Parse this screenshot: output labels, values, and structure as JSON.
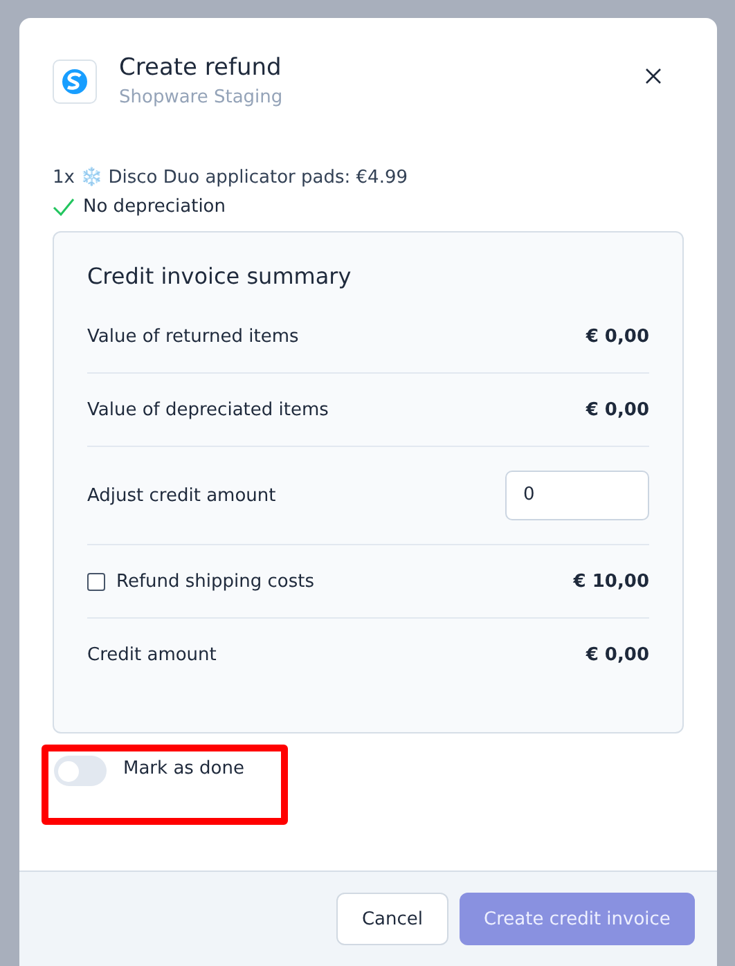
{
  "dialog": {
    "title": "Create refund",
    "subtitle": "Shopware Staging",
    "item": {
      "quantity": "1x",
      "emoji": "❄️",
      "text": "Disco Duo applicator pads: €4.99"
    },
    "depreciation": "No depreciation",
    "summary": {
      "title": "Credit invoice summary",
      "rows": [
        {
          "kind": "value",
          "label": "Value of returned items",
          "value": "€ 0,00"
        },
        {
          "kind": "value",
          "label": "Value of depreciated items",
          "value": "€ 0,00"
        },
        {
          "kind": "input",
          "label": "Adjust credit amount",
          "value": "0"
        },
        {
          "kind": "checkbox",
          "label": "Refund shipping costs",
          "checked": false,
          "value": "€ 10,00"
        },
        {
          "kind": "value",
          "label": "Credit amount",
          "value": "€ 0,00"
        }
      ]
    },
    "toggle": {
      "label": "Mark as done",
      "on": false,
      "highlighted": true
    },
    "buttons": [
      {
        "label": "Cancel",
        "kind": "secondary",
        "disabled": false
      },
      {
        "label": "Create credit invoice",
        "kind": "primary",
        "disabled": true
      }
    ]
  }
}
